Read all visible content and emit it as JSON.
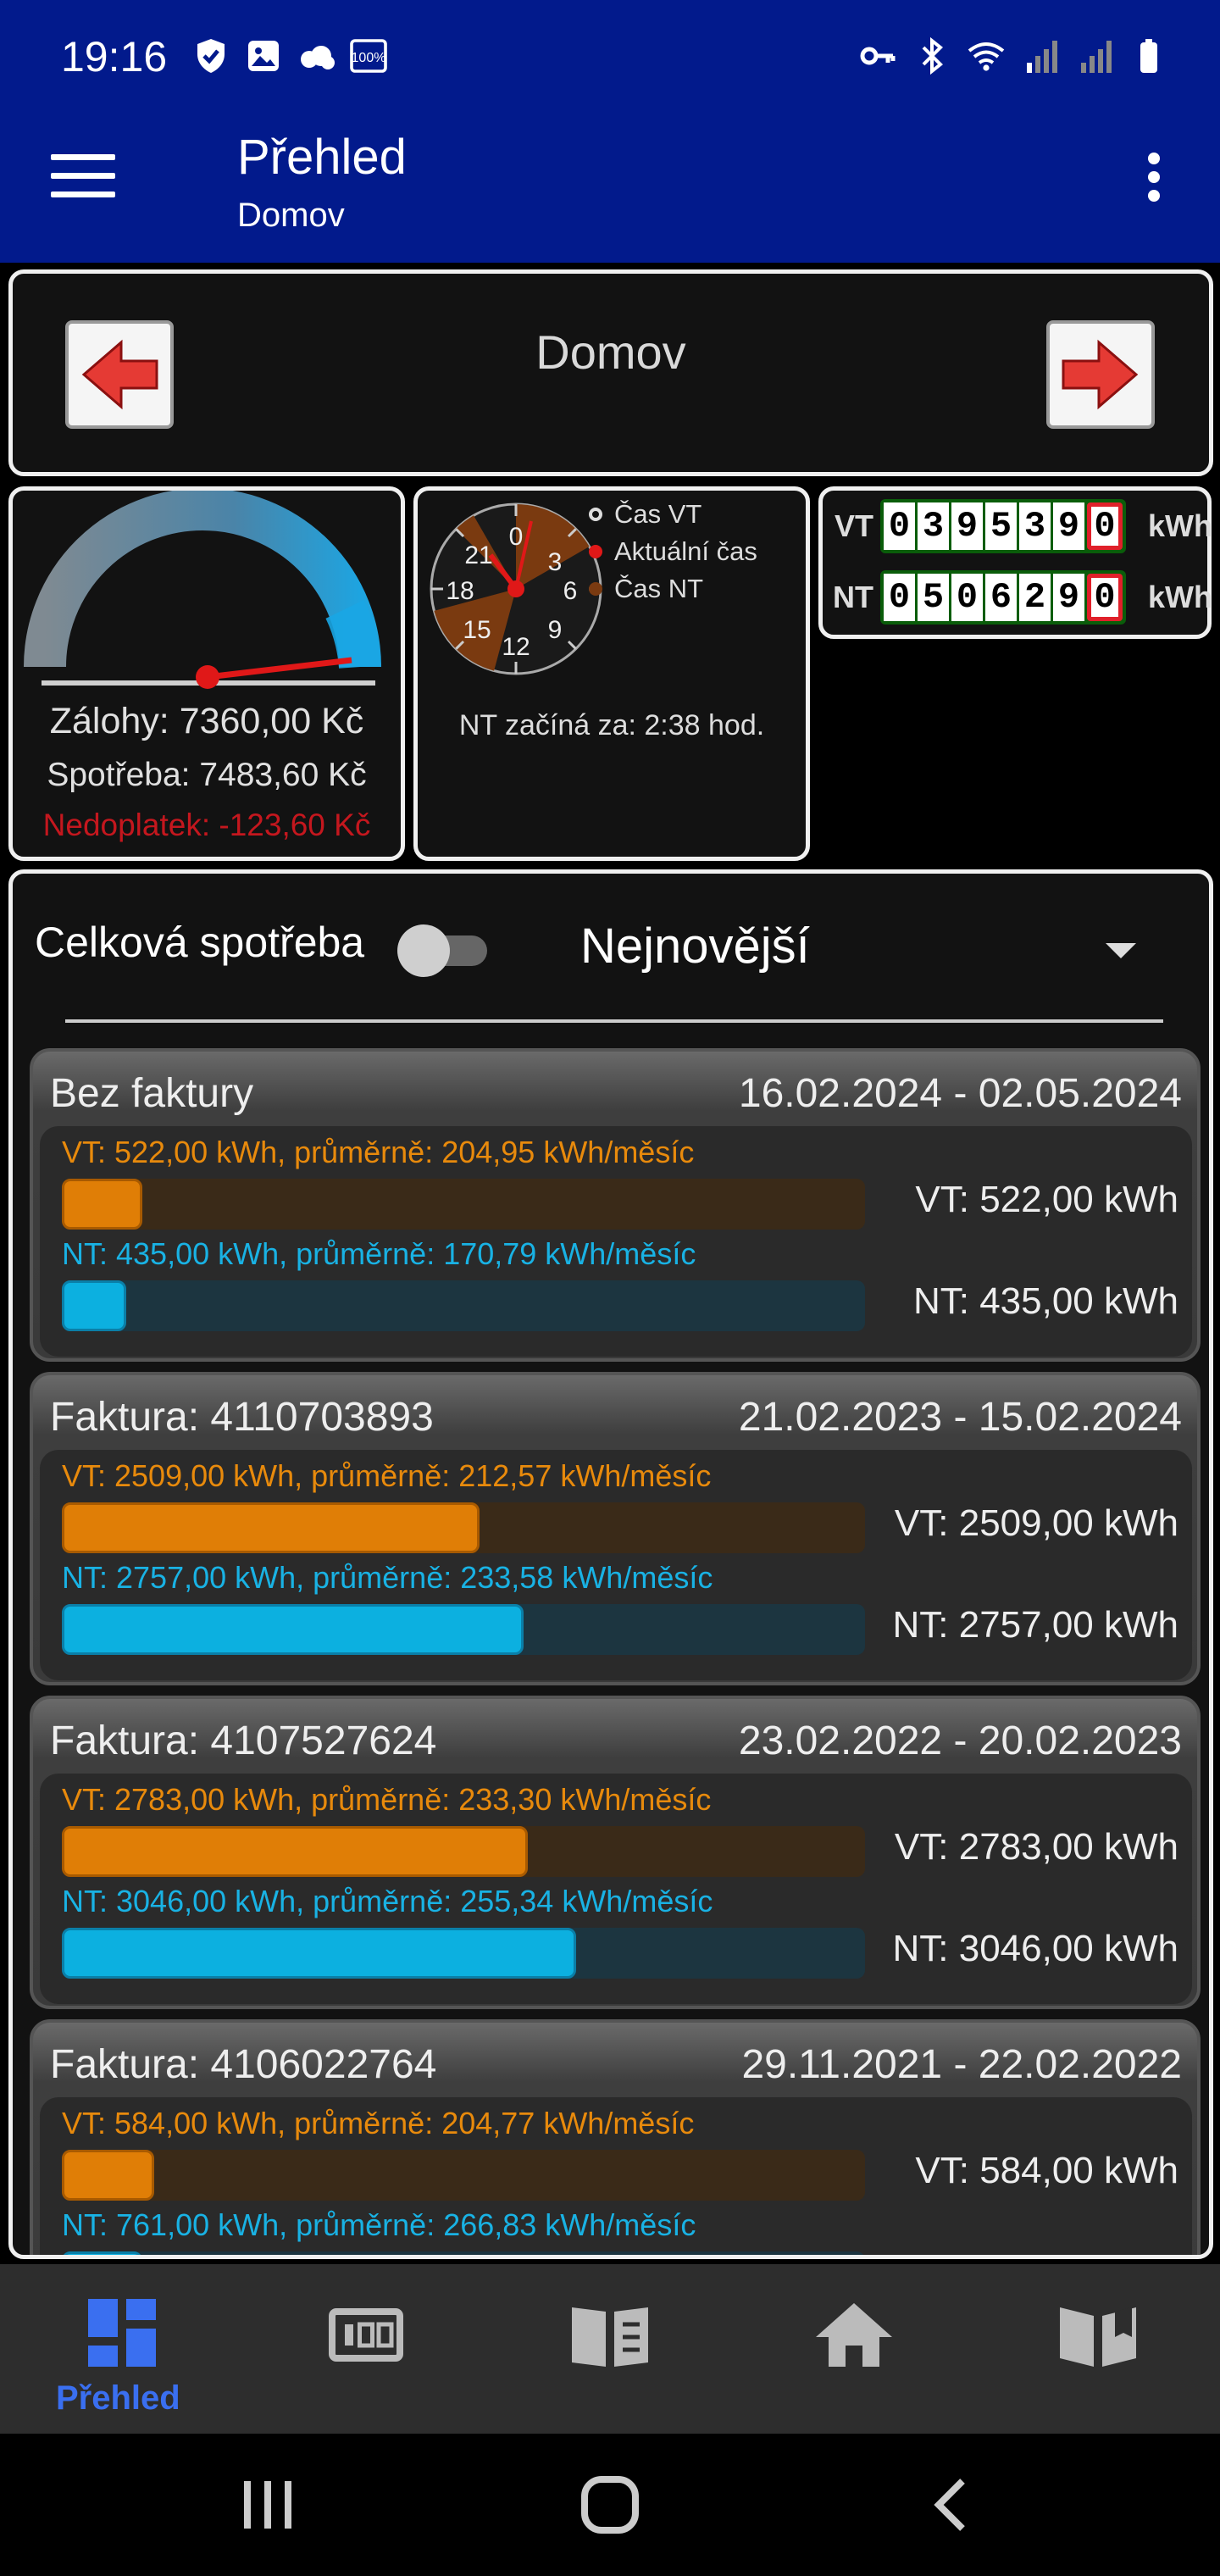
{
  "status_bar": {
    "time": "19:16",
    "battery_badge": "100%"
  },
  "app_bar": {
    "title": "Přehled",
    "subtitle": "Domov"
  },
  "nav": {
    "title": "Domov"
  },
  "gauge": {
    "zalohy": "Zálohy: 7360,00 Kč",
    "spotreba": "Spotřeba: 7483,60 Kč",
    "nedoplatek": "Nedoplatek: -123,60 Kč",
    "colors": {
      "underpay": "#c4171e"
    }
  },
  "clock": {
    "legend": [
      "Čas VT",
      "Aktuální čas",
      "Čas NT"
    ],
    "numbers": [
      "0",
      "3",
      "6",
      "9",
      "12",
      "15",
      "18",
      "21"
    ],
    "nt_starts": "NT začíná za: 2:38 hod."
  },
  "meters": {
    "vt": {
      "label": "VT",
      "digits": [
        "0",
        "3",
        "9",
        "5",
        "3",
        "9",
        "0"
      ],
      "unit": "kWh"
    },
    "nt": {
      "label": "NT",
      "digits": [
        "0",
        "5",
        "0",
        "6",
        "2",
        "9",
        "0"
      ],
      "unit": "kWh"
    }
  },
  "list": {
    "total_label": "Celková spotřeba",
    "sort_value": "Nejnovější",
    "colors": {
      "vt": "#e88a0c",
      "nt": "#19b2e4"
    },
    "cards": [
      {
        "name": "Bez faktury",
        "dates": "16.02.2024 - 02.05.2024",
        "vt_text": "VT: 522,00 kWh, průměrně: 204,95 kWh/měsíc",
        "vt_value": "VT: 522,00 kWh",
        "vt_fraction": 0.1,
        "nt_text": "NT: 435,00 kWh, průměrně: 170,79 kWh/měsíc",
        "nt_value": "NT: 435,00 kWh",
        "nt_fraction": 0.08
      },
      {
        "name": "Faktura: 4110703893",
        "dates": "21.02.2023 - 15.02.2024",
        "vt_text": "VT: 2509,00 kWh, průměrně: 212,57 kWh/měsíc",
        "vt_value": "VT: 2509,00 kWh",
        "vt_fraction": 0.52,
        "nt_text": "NT: 2757,00 kWh, průměrně: 233,58 kWh/měsíc",
        "nt_value": "NT: 2757,00 kWh",
        "nt_fraction": 0.575
      },
      {
        "name": "Faktura: 4107527624",
        "dates": "23.02.2022 - 20.02.2023",
        "vt_text": "VT: 2783,00 kWh, průměrně: 233,30 kWh/měsíc",
        "vt_value": "VT: 2783,00 kWh",
        "vt_fraction": 0.58,
        "nt_text": "NT: 3046,00 kWh, průměrně: 255,34 kWh/měsíc",
        "nt_value": "NT: 3046,00 kWh",
        "nt_fraction": 0.64
      },
      {
        "name": "Faktura: 4106022764",
        "dates": "29.11.2021 - 22.02.2022",
        "vt_text": "VT: 584,00 kWh, průměrně: 204,77 kWh/měsíc",
        "vt_value": "VT: 584,00 kWh",
        "vt_fraction": 0.115,
        "nt_text": "NT: 761,00 kWh, průměrně: 266,83 kWh/měsíc",
        "nt_value": "",
        "nt_fraction": 0.1
      }
    ]
  },
  "bottom_nav": {
    "active_label": "Přehled",
    "active_color": "#3a6ff0"
  }
}
